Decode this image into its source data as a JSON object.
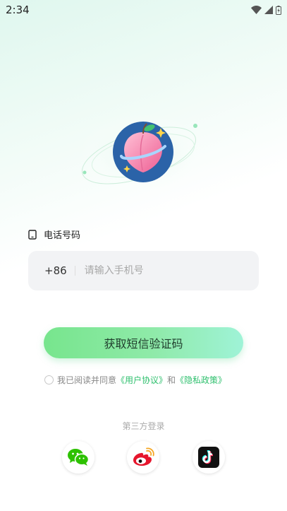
{
  "status_bar": {
    "time": "2:34"
  },
  "login": {
    "phone_label": "电话号码",
    "country_code": "+86",
    "phone_placeholder": "请输入手机号",
    "phone_value": "",
    "sms_button_label": "获取短信验证码",
    "agree_prefix": "我已阅读并同意",
    "user_agreement": "《用户协议》",
    "agree_and": "和",
    "privacy_policy": "《隐私政策》",
    "agree_checked": false
  },
  "third_party": {
    "title": "第三方登录",
    "providers": [
      {
        "name": "wechat",
        "icon": "wechat-icon",
        "color": "#2dc100"
      },
      {
        "name": "weibo",
        "icon": "weibo-icon",
        "color": "#e6162d"
      },
      {
        "name": "douyin",
        "icon": "douyin-icon",
        "color": "#111111"
      }
    ]
  },
  "colors": {
    "accent": "#2fc06e",
    "button_start": "#77e58d",
    "button_end": "#9ff3d7"
  }
}
